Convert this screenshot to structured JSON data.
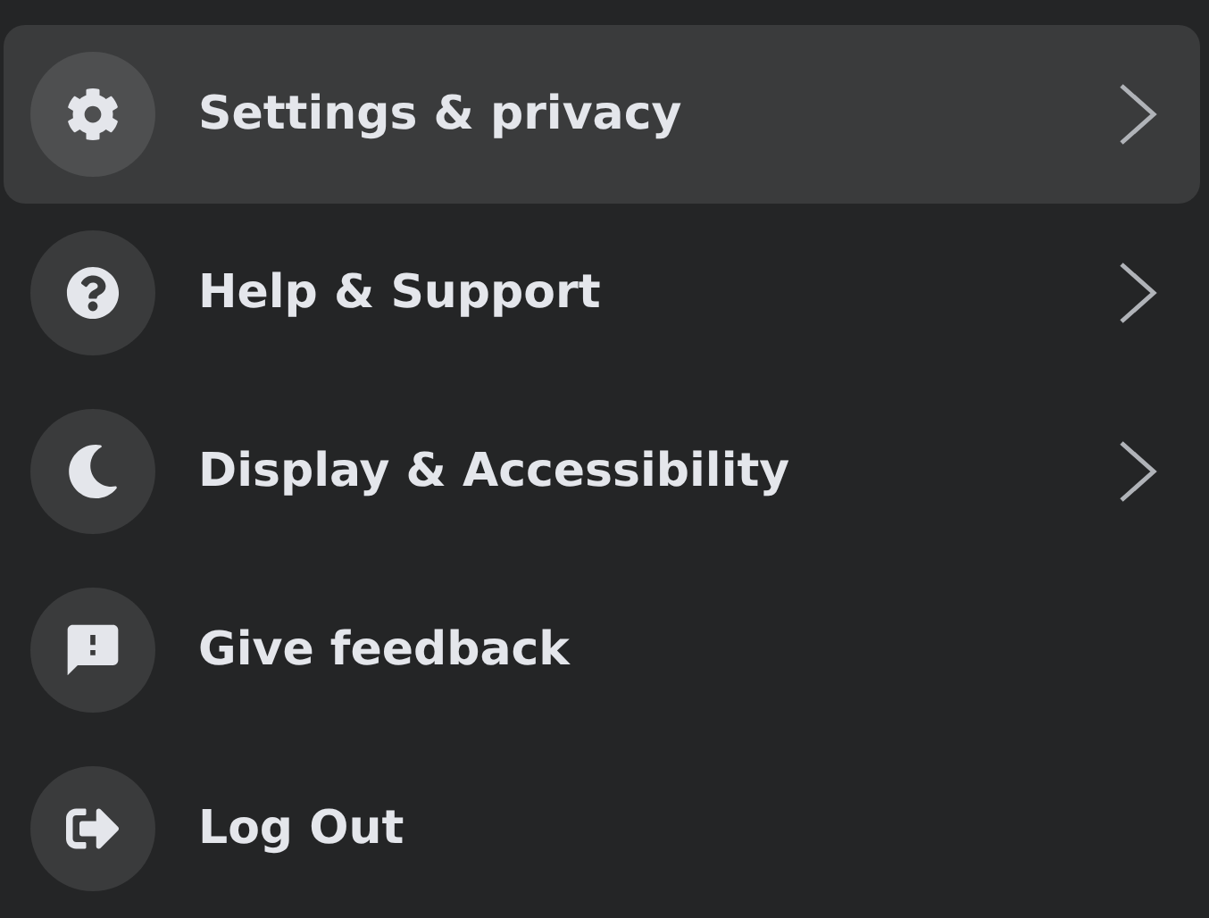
{
  "menu": {
    "items": [
      {
        "label": "Settings & privacy",
        "selected": true,
        "has_submenu": true
      },
      {
        "label": "Help & Support",
        "selected": false,
        "has_submenu": true
      },
      {
        "label": "Display & Accessibility",
        "selected": false,
        "has_submenu": true
      },
      {
        "label": "Give feedback",
        "selected": false,
        "has_submenu": false
      },
      {
        "label": "Log Out",
        "selected": false,
        "has_submenu": false
      }
    ]
  }
}
